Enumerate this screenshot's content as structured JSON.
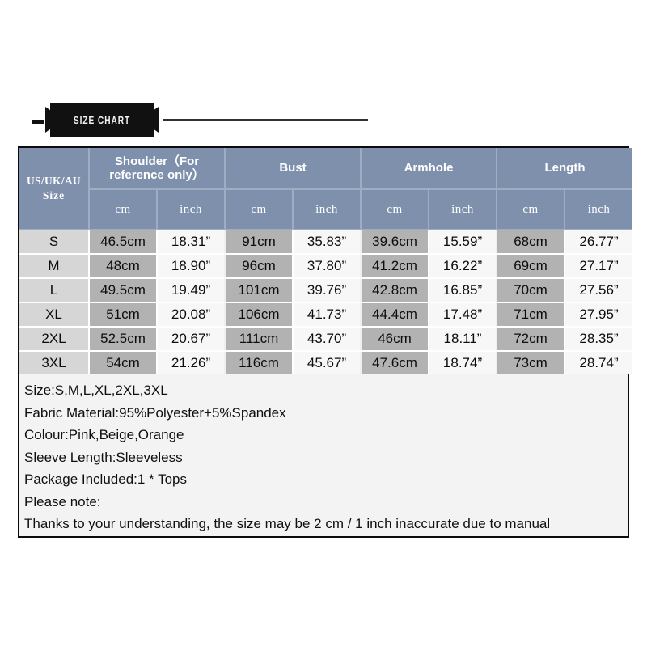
{
  "banner": {
    "title": "SIZE CHART",
    "dash_icon": "dash-icon",
    "rule_icon": "horizontal-rule-icon"
  },
  "table": {
    "group_headers": [
      {
        "label": "Size",
        "span": 1
      },
      {
        "label": "Shoulder（For reference only）",
        "span": 2
      },
      {
        "label": "Bust",
        "span": 2
      },
      {
        "label": "Armhole",
        "span": 2
      },
      {
        "label": "Length",
        "span": 2
      }
    ],
    "size_header_line1": "US/UK/AU",
    "size_header_line2": "Size",
    "unit_headers": [
      "cm",
      "inch",
      "cm",
      "inch",
      "cm",
      "inch",
      "cm",
      "inch"
    ],
    "rows": [
      {
        "size": "S",
        "shoulder_cm": "46.5cm",
        "shoulder_inch": "18.31”",
        "bust_cm": "91cm",
        "bust_inch": "35.83”",
        "armhole_cm": "39.6cm",
        "armhole_inch": "15.59”",
        "length_cm": "68cm",
        "length_inch": "26.77”"
      },
      {
        "size": "M",
        "shoulder_cm": "48cm",
        "shoulder_inch": "18.90”",
        "bust_cm": "96cm",
        "bust_inch": "37.80”",
        "armhole_cm": "41.2cm",
        "armhole_inch": "16.22”",
        "length_cm": "69cm",
        "length_inch": "27.17”"
      },
      {
        "size": "L",
        "shoulder_cm": "49.5cm",
        "shoulder_inch": "19.49”",
        "bust_cm": "101cm",
        "bust_inch": "39.76”",
        "armhole_cm": "42.8cm",
        "armhole_inch": "16.85”",
        "length_cm": "70cm",
        "length_inch": "27.56”"
      },
      {
        "size": "XL",
        "shoulder_cm": "51cm",
        "shoulder_inch": "20.08”",
        "bust_cm": "106cm",
        "bust_inch": "41.73”",
        "armhole_cm": "44.4cm",
        "armhole_inch": "17.48”",
        "length_cm": "71cm",
        "length_inch": "27.95”"
      },
      {
        "size": "2XL",
        "shoulder_cm": "52.5cm",
        "shoulder_inch": "20.67”",
        "bust_cm": "111cm",
        "bust_inch": "43.70”",
        "armhole_cm": "46cm",
        "armhole_inch": "18.11”",
        "length_cm": "72cm",
        "length_inch": "28.35”"
      },
      {
        "size": "3XL",
        "shoulder_cm": "54cm",
        "shoulder_inch": "21.26”",
        "bust_cm": "116cm",
        "bust_inch": "45.67”",
        "armhole_cm": "47.6cm",
        "armhole_inch": "18.74”",
        "length_cm": "73cm",
        "length_inch": "28.74”"
      }
    ]
  },
  "description": {
    "lines": [
      "Size:S,M,L,XL,2XL,3XL",
      "Fabric Material:95%Polyester+5%Spandex",
      "Colour:Pink,Beige,Orange",
      "Sleeve Length:Sleeveless",
      "Package Included:1 * Tops",
      "Please note:",
      "Thanks to your understanding, the size may be 2 cm / 1 inch inaccurate due to manual"
    ]
  },
  "colors": {
    "header_blue": "#7f90ac",
    "cm_cell_gray": "#b2b2b2",
    "inch_cell_white": "#f7f7f7",
    "size_cell_gray": "#d6d6d6",
    "banner_black": "#111111",
    "border_black": "#0b0b0b"
  }
}
